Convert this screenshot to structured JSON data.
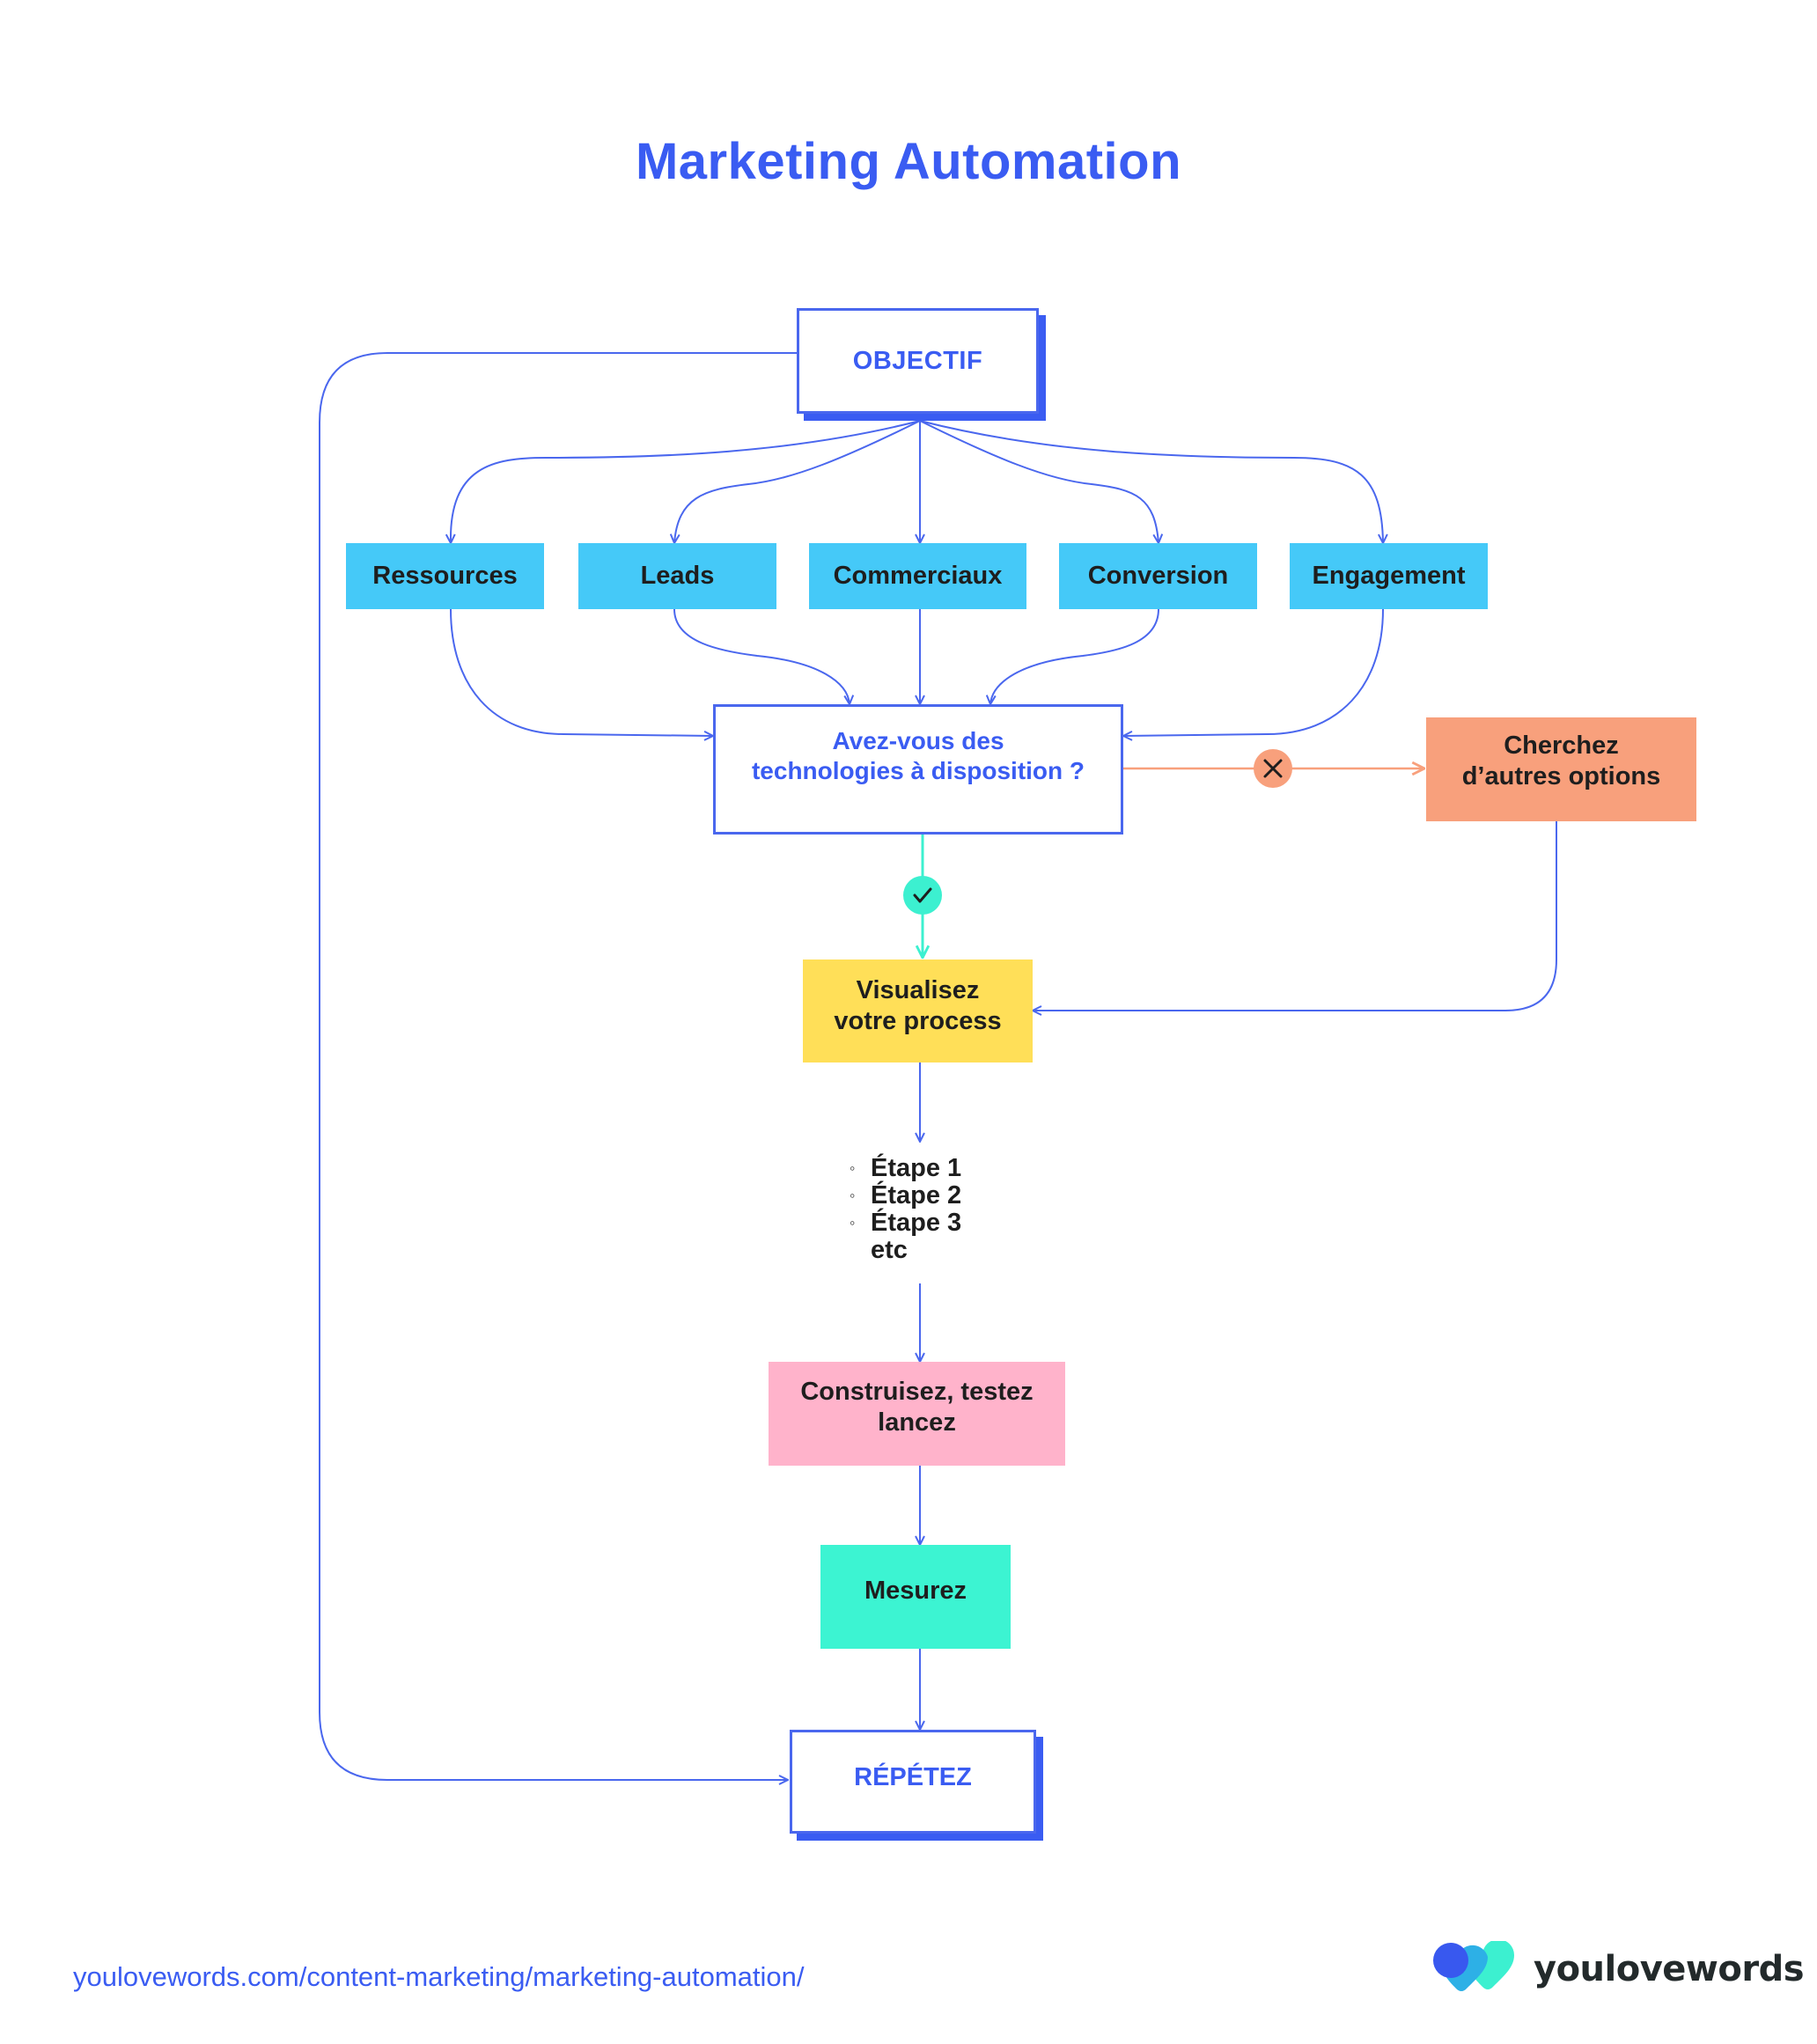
{
  "title": "Marketing Automation",
  "colors": {
    "accent_blue": "#3a5cf2",
    "line_blue": "#4a67ee",
    "category_cyan": "#45c9f8",
    "no_orange": "#f8a07c",
    "yes_teal": "#3cf0d0",
    "visualize_yellow": "#ffdf58",
    "build_pink": "#ffb3cb",
    "measure_teal": "#3cf4d2"
  },
  "nodes": {
    "objectif": "OBJECTIF",
    "categories": [
      "Ressources",
      "Leads",
      "Commerciaux",
      "Conversion",
      "Engagement"
    ],
    "question": {
      "line1": "Avez-vous des",
      "line2": "technologies à disposition ?"
    },
    "alternative": {
      "line1": "Cherchez",
      "line2": "d’autres options"
    },
    "visualize": {
      "line1": "Visualisez",
      "line2": "votre process"
    },
    "steps": {
      "items": [
        "Étape 1",
        "Étape 2",
        "Étape 3"
      ],
      "bullet": "◦",
      "tail": "etc"
    },
    "build": {
      "line1": "Construisez, testez",
      "line2": "lancez"
    },
    "measure": "Mesurez",
    "repeat": "RÉPÉTEZ"
  },
  "decisions": {
    "yes_icon": "check-icon",
    "yes_glyph": "✓",
    "no_icon": "x-icon",
    "no_glyph": "✕"
  },
  "footer": {
    "url": "youlovewords.com/content-marketing/marketing-automation/",
    "brand": "youlovewords"
  }
}
